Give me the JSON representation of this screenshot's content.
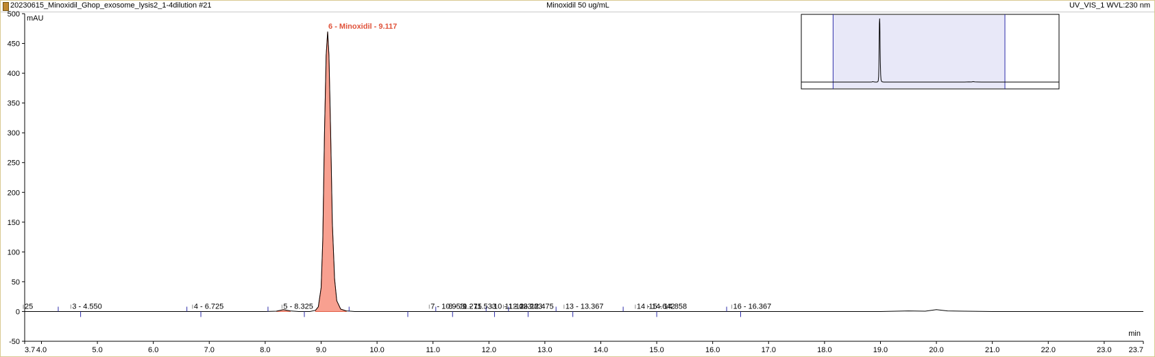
{
  "header": {
    "file_name": "20230615_Minoxidil_Ghop_exosome_lysis2_1-4dilution #21",
    "sample_name": "Minoxidil 50 ug/mL",
    "channel": "UV_VIS_1 WVL:230 nm"
  },
  "chart_data": {
    "type": "line",
    "ylabel": "mAU",
    "xlabel": "min",
    "xlim": [
      3.7,
      23.7
    ],
    "ylim": [
      -50,
      500
    ],
    "x_ticks": [
      "3.7",
      "4.0",
      "5.0",
      "6.0",
      "7.0",
      "8.0",
      "9.0",
      "10.0",
      "11.0",
      "12.0",
      "13.0",
      "14.0",
      "15.0",
      "16.0",
      "17.0",
      "18.0",
      "19.0",
      "20.0",
      "21.0",
      "22.0",
      "23.0",
      "23.7"
    ],
    "y_ticks": [
      "-50",
      "0",
      "50",
      "100",
      "150",
      "200",
      "250",
      "300",
      "350",
      "400",
      "450",
      "500"
    ],
    "trace": {
      "x": [
        3.7,
        4.0,
        4.5,
        5.0,
        6.0,
        7.0,
        8.0,
        8.2,
        8.325,
        8.45,
        8.6,
        8.8,
        8.9,
        8.95,
        9.0,
        9.03,
        9.06,
        9.09,
        9.117,
        9.14,
        9.17,
        9.2,
        9.24,
        9.28,
        9.35,
        9.45,
        9.6,
        10.0,
        11.0,
        12.0,
        13.0,
        14.0,
        15.0,
        16.0,
        17.0,
        18.0,
        19.0,
        19.5,
        19.8,
        20.0,
        20.2,
        20.5,
        21.0,
        22.0,
        23.0,
        23.7
      ],
      "y": [
        0,
        0,
        0,
        0,
        0,
        0,
        0,
        0.5,
        3,
        1,
        0,
        0,
        2,
        8,
        40,
        120,
        300,
        430,
        470,
        430,
        300,
        150,
        55,
        18,
        4,
        1,
        0,
        0,
        0,
        0,
        0,
        0,
        0,
        0,
        0,
        0,
        0,
        1,
        0.5,
        3,
        1,
        0.5,
        0,
        0,
        0,
        0
      ]
    },
    "peaks": [
      {
        "label": "25",
        "rt": 3.7,
        "major": false
      },
      {
        "label": "3 - 4.550",
        "rt": 4.55,
        "major": false
      },
      {
        "label": "4 - 6.725",
        "rt": 6.725,
        "major": false
      },
      {
        "label": "5 - 8.325",
        "rt": 8.325,
        "major": false
      },
      {
        "label": "6 - Minoxidil - 9.117",
        "rt": 9.117,
        "major": true
      },
      {
        "label": "7 - 10.958",
        "rt": 10.958,
        "major": false
      },
      {
        "label": "8 - 11.275",
        "rt": 11.275,
        "major": false
      },
      {
        "label": "9 - 11.533",
        "rt": 11.533,
        "major": false
      },
      {
        "label": "10 - 12.083",
        "rt": 12.083,
        "major": false
      },
      {
        "label": "11 - 12.283",
        "rt": 12.283,
        "major": false
      },
      {
        "label": "12 - 12.475",
        "rt": 12.475,
        "major": false
      },
      {
        "label": "13 - 13.367",
        "rt": 13.367,
        "major": false
      },
      {
        "label": "14 - 14.642",
        "rt": 14.642,
        "major": false
      },
      {
        "label": "15 - 14.858",
        "rt": 14.858,
        "major": false
      },
      {
        "label": "16 - 16.367",
        "rt": 16.367,
        "major": false
      }
    ],
    "peak_bounds": [
      4.3,
      4.7,
      6.6,
      6.85,
      8.05,
      8.7,
      9.5,
      10.55,
      11.05,
      11.35,
      11.95,
      12.1,
      12.35,
      12.7,
      13.2,
      13.5,
      14.4,
      15.0,
      16.25,
      16.5
    ],
    "inset": {
      "window_start": 3.7,
      "window_end": 23.7,
      "total_start": 0,
      "total_end": 30
    },
    "colors": {
      "trace": "#000000",
      "peak_fill": "#f8a090",
      "peak_edge": "#e05a40",
      "major_label": "#e0523a",
      "bound": "#2a2aa8",
      "inset_window": "#e8e8f8"
    }
  }
}
